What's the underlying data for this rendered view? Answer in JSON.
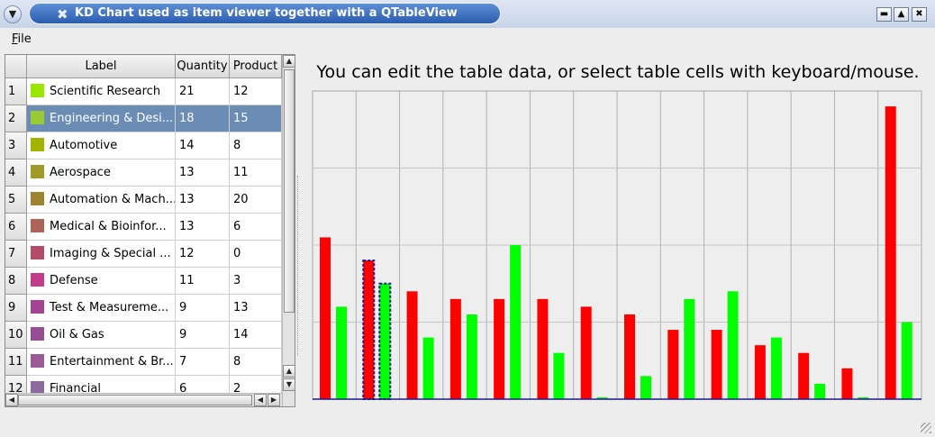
{
  "window": {
    "title": "KD Chart used as item viewer together with a QTableView",
    "title_icon": "tools-icon",
    "sys_menu_icon": "chevron-down-icon",
    "minimize_icon": "minimize-icon",
    "maximize_icon": "maximize-icon",
    "close_icon": "close-icon",
    "title_color": "#2a5cb0"
  },
  "menu": {
    "file": "File"
  },
  "table": {
    "headers": {
      "label": "Label",
      "quantity": "Quantity",
      "product": "Product"
    },
    "selected_row": 2,
    "selection_color": "#6b8cb4",
    "rows": [
      {
        "num": "1",
        "label": "Scientific Research",
        "color": "#99e600",
        "quantity": "21",
        "product": "12"
      },
      {
        "num": "2",
        "label": "Engineering & Desi...",
        "color": "#99cc33",
        "quantity": "18",
        "product": "15"
      },
      {
        "num": "3",
        "label": "Automotive",
        "color": "#a3b300",
        "quantity": "14",
        "product": "8"
      },
      {
        "num": "4",
        "label": "Aerospace",
        "color": "#a09a2a",
        "quantity": "13",
        "product": "11"
      },
      {
        "num": "5",
        "label": "Automation & Mach...",
        "color": "#9e8331",
        "quantity": "13",
        "product": "20"
      },
      {
        "num": "6",
        "label": "Medical & Bioinfor...",
        "color": "#ad6357",
        "quantity": "13",
        "product": "6"
      },
      {
        "num": "7",
        "label": "Imaging & Special ...",
        "color": "#b24c67",
        "quantity": "12",
        "product": "0"
      },
      {
        "num": "8",
        "label": "Defense",
        "color": "#c13d8a",
        "quantity": "11",
        "product": "3"
      },
      {
        "num": "9",
        "label": "Test & Measureme...",
        "color": "#a44593",
        "quantity": "9",
        "product": "13"
      },
      {
        "num": "10",
        "label": "Oil & Gas",
        "color": "#974d91",
        "quantity": "9",
        "product": "14"
      },
      {
        "num": "11",
        "label": "Entertainment & Br...",
        "color": "#9a5a97",
        "quantity": "7",
        "product": "8"
      },
      {
        "num": "12",
        "label": "Financial",
        "color": "#8c6a9f",
        "quantity": "6",
        "product": "2"
      }
    ]
  },
  "headline": "You can edit the table data, or select table cells with keyboard/mouse.",
  "chart_data": {
    "type": "bar",
    "ylim": [
      0,
      40
    ],
    "grid": true,
    "selected_index": 1,
    "colors": {
      "quantity": "#ff0000",
      "product": "#00ff00",
      "selection_outline": "#1a1a8c",
      "axis": "#1a1a8c"
    },
    "series": [
      {
        "values": [
          21,
          18,
          14,
          13,
          13,
          13,
          12,
          11,
          9,
          9,
          7,
          6,
          4,
          38
        ]
      },
      {
        "values": [
          12,
          15,
          8,
          11,
          20,
          6,
          0,
          3,
          13,
          14,
          8,
          2,
          0,
          10
        ]
      }
    ]
  }
}
